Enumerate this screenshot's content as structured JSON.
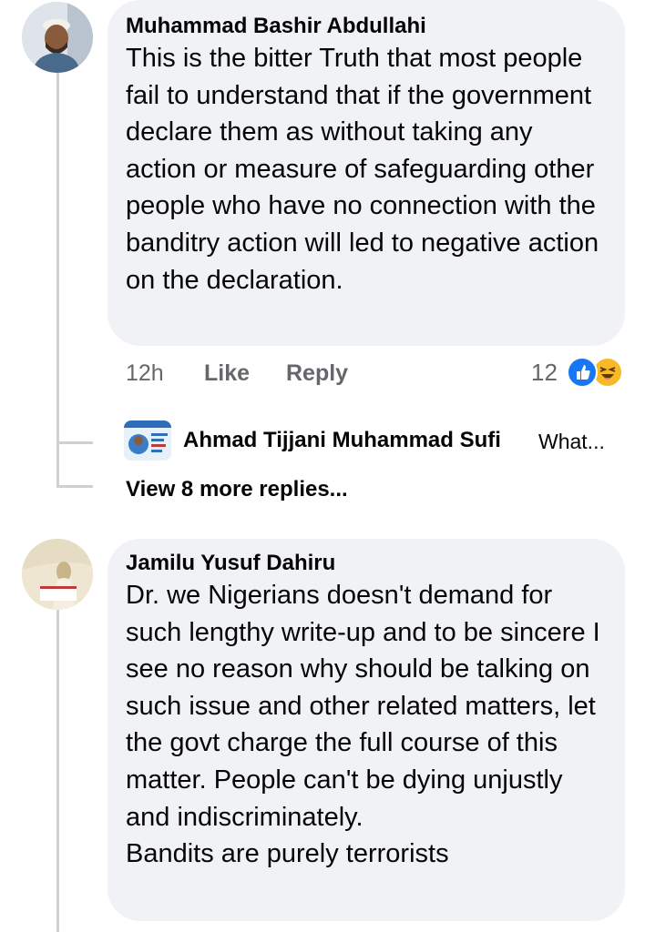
{
  "comments": [
    {
      "author": "Muhammad Bashir Abdullahi",
      "text": "This is the bitter Truth that most people fail to understand that if the government declare them as without taking any action or measure of safeguarding other people who have no connection with the banditry action will led to negative action on the declaration.",
      "time": "12h",
      "like_label": "Like",
      "reply_label": "Reply",
      "reaction_count": "12",
      "reaction_icons": [
        "like-icon",
        "haha-icon"
      ],
      "replies_preview": {
        "author": "Ahmad Tijjani Muhammad Sufi",
        "snippet": "What...",
        "avatar_caption": "AHMAD TIJJANI"
      },
      "view_more_label": "View 8 more replies..."
    },
    {
      "author": "Jamilu Yusuf Dahiru",
      "text": "Dr. we Nigerians doesn't demand for such lengthy write-up and to be sincere I see no reason why should be talking on such issue and other related matters, let the govt charge the full course of this matter. People can't be dying unjustly and indiscriminately.\nBandits are purely terrorists",
      "avatar_caption": "SAHARA REPORTERS"
    }
  ],
  "colors": {
    "bubble_bg": "#f0f2f5",
    "meta_text": "#65676b",
    "like_blue": "#1877f2",
    "haha_yellow": "#f7b928",
    "thread_line": "#ced0d4"
  }
}
